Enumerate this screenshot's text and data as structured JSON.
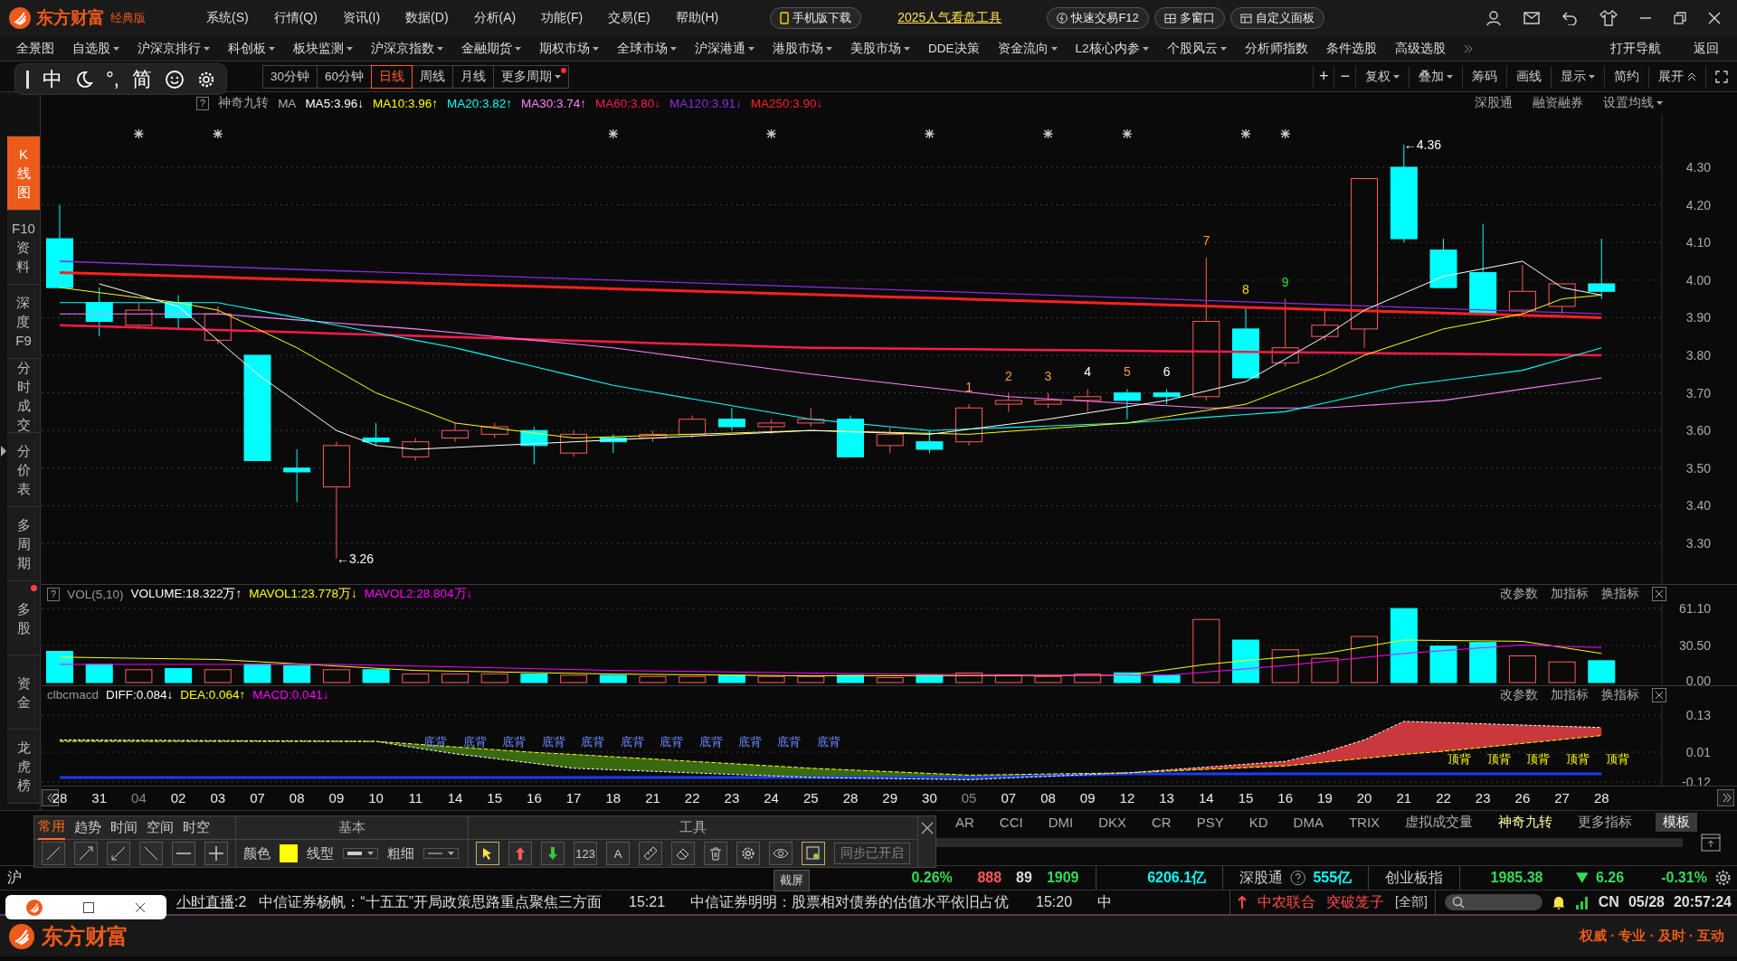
{
  "title_bar": {
    "logo": "东方财富",
    "edition": "经典版",
    "menus": [
      "系统(S)",
      "行情(Q)",
      "资讯(I)",
      "数据(D)",
      "分析(A)",
      "功能(F)",
      "交易(E)",
      "帮助(H)"
    ],
    "mobile_button": "手机版下载",
    "promo_link": "2025人气看盘工具",
    "quick_trade": "快速交易F12",
    "multi_window": "多窗口",
    "custom_panel": "自定义面板"
  },
  "menu_bar": [
    {
      "label": "全景图",
      "dropdown": false
    },
    {
      "label": "自选股",
      "dropdown": true
    },
    {
      "label": "沪深京排行",
      "dropdown": true
    },
    {
      "label": "科创板",
      "dropdown": true
    },
    {
      "label": "板块监测",
      "dropdown": true
    },
    {
      "label": "沪深京指数",
      "dropdown": true
    },
    {
      "label": "金融期货",
      "dropdown": true
    },
    {
      "label": "期权市场",
      "dropdown": true
    },
    {
      "label": "全球市场",
      "dropdown": true
    },
    {
      "label": "沪深港通",
      "dropdown": true
    },
    {
      "label": "港股市场",
      "dropdown": true
    },
    {
      "label": "美股市场",
      "dropdown": true
    },
    {
      "label": "DDE决策",
      "dropdown": false
    },
    {
      "label": "资金流向",
      "dropdown": true
    },
    {
      "label": "L2核心内参",
      "dropdown": true
    },
    {
      "label": "个股风云",
      "dropdown": true
    },
    {
      "label": "分析师指数",
      "dropdown": false
    },
    {
      "label": "条件选股",
      "dropdown": false
    },
    {
      "label": "高级选股",
      "dropdown": false
    }
  ],
  "menu_bar_right": [
    "打开导航",
    "返回"
  ],
  "float_toolbar": [
    {
      "kind": "handle"
    },
    {
      "kind": "text",
      "label": "中"
    },
    {
      "kind": "moon"
    },
    {
      "kind": "text",
      "label": "°,"
    },
    {
      "kind": "text",
      "label": "简"
    },
    {
      "kind": "smile"
    },
    {
      "kind": "gear"
    }
  ],
  "period_tabs": [
    {
      "label": "30分钟",
      "selected": false,
      "dropdown": false,
      "alert": false
    },
    {
      "label": "60分钟",
      "selected": false,
      "dropdown": false,
      "alert": false
    },
    {
      "label": "日线",
      "selected": true,
      "dropdown": false,
      "alert": false
    },
    {
      "label": "周线",
      "selected": false,
      "dropdown": false,
      "alert": false
    },
    {
      "label": "月线",
      "selected": false,
      "dropdown": false,
      "alert": false
    },
    {
      "label": "更多周期",
      "selected": false,
      "dropdown": true,
      "alert": true
    }
  ],
  "chart_tools": [
    {
      "kind": "icon",
      "label": "+",
      "dropdown": false
    },
    {
      "kind": "icon",
      "label": "−",
      "dropdown": false
    },
    {
      "kind": "text",
      "label": "复权",
      "dropdown": true
    },
    {
      "kind": "text",
      "label": "叠加",
      "dropdown": true
    },
    {
      "kind": "text",
      "label": "筹码",
      "dropdown": false
    },
    {
      "kind": "text",
      "label": "画线",
      "dropdown": false
    },
    {
      "kind": "text",
      "label": "显示",
      "dropdown": true
    },
    {
      "kind": "text",
      "label": "简约",
      "dropdown": false
    },
    {
      "kind": "expand",
      "label": "展开",
      "dropdown": false
    },
    {
      "kind": "fullscreen"
    }
  ],
  "sidebar": [
    {
      "label": "K线图",
      "selected": true,
      "alert": false
    },
    {
      "label": "F10资料",
      "selected": false,
      "alert": false
    },
    {
      "label": "深度F9",
      "selected": false,
      "alert": false
    },
    {
      "label": "分时成交",
      "selected": false,
      "alert": false
    },
    {
      "label": "分价表",
      "selected": false,
      "alert": false
    },
    {
      "label": "多周期",
      "selected": false,
      "alert": false
    },
    {
      "label": "多股",
      "selected": false,
      "alert": true
    },
    {
      "label": "资金",
      "selected": false,
      "alert": false
    },
    {
      "label": "龙虎榜",
      "selected": false,
      "alert": false
    }
  ],
  "ma_bar": {
    "help": "?",
    "indicator": "神奇九转",
    "label": "MA",
    "values": [
      {
        "text": "MA5:3.96↓",
        "color": "#ffffff"
      },
      {
        "text": "MA10:3.96↑",
        "color": "#ffff00"
      },
      {
        "text": "MA20:3.82↑",
        "color": "#00ffff"
      },
      {
        "text": "MA30:3.74↑",
        "color": "#ff80ff"
      },
      {
        "text": "MA60:3.80↓",
        "color": "#ff1a4a"
      },
      {
        "text": "MA120:3.91↓",
        "color": "#8a2be2"
      },
      {
        "text": "MA250:3.90↓",
        "color": "#ff2020"
      }
    ],
    "links": [
      "深股通",
      "融资融券",
      "设置均线"
    ]
  },
  "price_chart": {
    "ticks": [
      "4.30",
      "4.20",
      "4.10",
      "4.00",
      "3.90",
      "3.80",
      "3.70",
      "3.60",
      "3.50",
      "3.40",
      "3.30"
    ],
    "high_label": "←4.36",
    "low_label": "←3.26",
    "nine_turn": [
      {
        "text": "1",
        "color": "#ff9f2a"
      },
      {
        "text": "2",
        "color": "#ff9f2a"
      },
      {
        "text": "3",
        "color": "#ff9f2a"
      },
      {
        "text": "4",
        "color": "#ffffff"
      },
      {
        "text": "5",
        "color": "#ff9f2a"
      },
      {
        "text": "6",
        "color": "#ffffff"
      },
      {
        "text": "7",
        "color": "#ff9f2a"
      },
      {
        "text": "8",
        "color": "#ffd700"
      },
      {
        "text": "9",
        "color": "#33dd33"
      }
    ]
  },
  "volume_panel": {
    "help": "?",
    "name": "VOL(5,10)",
    "values": [
      {
        "text": "VOLUME:18.322万↑",
        "color": "#ffffff"
      },
      {
        "text": "MAVOL1:23.778万↓",
        "color": "#ffff00"
      },
      {
        "text": "MAVOL2:28.804万↓",
        "color": "#ff00ff"
      }
    ],
    "actions": [
      "改参数",
      "加指标",
      "换指标"
    ],
    "ticks": [
      "61.10",
      "30.50",
      "0.00"
    ]
  },
  "macd_panel": {
    "name": "clbcmacd",
    "values": [
      {
        "text": "DIFF:0.084↓",
        "color": "#ffffff"
      },
      {
        "text": "DEA:0.064↑",
        "color": "#ffff00"
      },
      {
        "text": "MACD:0.041↓",
        "color": "#ff00ff"
      }
    ],
    "actions": [
      "改参数",
      "加指标",
      "换指标"
    ],
    "ticks": [
      "0.13",
      "0.01",
      "-0.12"
    ],
    "bottom_signals": [
      "底背",
      "底背",
      "底背",
      "底背",
      "底背",
      "底背",
      "底背",
      "底背",
      "底背",
      "底背",
      "底背"
    ],
    "top_signals": [
      "顶背",
      "顶背",
      "顶背",
      "顶背",
      "顶背"
    ]
  },
  "date_axis": [
    {
      "text": "28",
      "month": false
    },
    {
      "text": "31",
      "month": false
    },
    {
      "text": "04",
      "month": true
    },
    {
      "text": "02",
      "month": false
    },
    {
      "text": "03",
      "month": false
    },
    {
      "text": "07",
      "month": false
    },
    {
      "text": "08",
      "month": false
    },
    {
      "text": "09",
      "month": false
    },
    {
      "text": "10",
      "month": false
    },
    {
      "text": "11",
      "month": false
    },
    {
      "text": "14",
      "month": false
    },
    {
      "text": "15",
      "month": false
    },
    {
      "text": "16",
      "month": false
    },
    {
      "text": "17",
      "month": false
    },
    {
      "text": "18",
      "month": false
    },
    {
      "text": "21",
      "month": false
    },
    {
      "text": "22",
      "month": false
    },
    {
      "text": "23",
      "month": false
    },
    {
      "text": "24",
      "month": false
    },
    {
      "text": "25",
      "month": false
    },
    {
      "text": "28",
      "month": false
    },
    {
      "text": "29",
      "month": false
    },
    {
      "text": "30",
      "month": false
    },
    {
      "text": "05",
      "month": true
    },
    {
      "text": "07",
      "month": false
    },
    {
      "text": "08",
      "month": false
    },
    {
      "text": "09",
      "month": false
    },
    {
      "text": "12",
      "month": false
    },
    {
      "text": "13",
      "month": false
    },
    {
      "text": "14",
      "month": false
    },
    {
      "text": "15",
      "month": false
    },
    {
      "text": "16",
      "month": false
    },
    {
      "text": "19",
      "month": false
    },
    {
      "text": "20",
      "month": false
    },
    {
      "text": "21",
      "month": false
    },
    {
      "text": "22",
      "month": false
    },
    {
      "text": "23",
      "month": false
    },
    {
      "text": "26",
      "month": false
    },
    {
      "text": "27",
      "month": false
    },
    {
      "text": "28",
      "month": false
    }
  ],
  "indicator_tabs": [
    {
      "kind": "tab",
      "label": "AR",
      "selected": false
    },
    {
      "kind": "tab",
      "label": "CCI",
      "selected": false
    },
    {
      "kind": "tab",
      "label": "DMI",
      "selected": false
    },
    {
      "kind": "tab",
      "label": "DKX",
      "selected": false
    },
    {
      "kind": "tab",
      "label": "CR",
      "selected": false
    },
    {
      "kind": "tab",
      "label": "PSY",
      "selected": false
    },
    {
      "kind": "tab",
      "label": "KD",
      "selected": false
    },
    {
      "kind": "tab",
      "label": "DMA",
      "selected": false
    },
    {
      "kind": "tab",
      "label": "TRIX",
      "selected": false
    },
    {
      "kind": "tab",
      "label": "虚拟成交量",
      "selected": false
    },
    {
      "kind": "tab",
      "label": "神奇九转",
      "selected": true
    },
    {
      "kind": "tab",
      "label": "更多指标",
      "selected": false
    },
    {
      "kind": "button",
      "label": "模板",
      "selected": false
    }
  ],
  "draw_panel": {
    "tabs": [
      {
        "label": "常用",
        "selected": true
      },
      {
        "label": "趋势",
        "selected": false
      },
      {
        "label": "时间",
        "selected": false
      },
      {
        "label": "空间",
        "selected": false
      },
      {
        "label": "时空",
        "selected": false
      }
    ],
    "basic_title": "基本",
    "tools_title": "工具",
    "color_label": "颜色",
    "color": "#ffff00",
    "line_type_label": "线型",
    "thickness_label": "粗细",
    "tools": [
      {
        "kind": "cursor"
      },
      {
        "kind": "up"
      },
      {
        "kind": "down"
      },
      {
        "kind": "text",
        "label": "123"
      },
      {
        "kind": "text",
        "label": "A"
      },
      {
        "kind": "ruler"
      },
      {
        "kind": "eraser"
      },
      {
        "kind": "trash"
      },
      {
        "kind": "gear"
      },
      {
        "kind": "eye"
      },
      {
        "kind": "screenshot"
      }
    ],
    "sync_button": "同步已开启",
    "tooltip": "截屏"
  },
  "status_bar": {
    "market": "沪",
    "items": [
      {
        "text": "0.26%",
        "color": "#33dd55"
      },
      {
        "text": "888",
        "color": "#ff5a5a"
      },
      {
        "text": "89",
        "color": "#dddddd"
      },
      {
        "text": "1909",
        "color": "#33dd55"
      },
      {
        "text": "6206.1亿",
        "color": "#00ffff"
      },
      {
        "text": "深股通",
        "color": "#cccccc"
      },
      {
        "text": "555亿",
        "color": "#00ffff"
      },
      {
        "text": "创业板指",
        "color": "#cccccc"
      },
      {
        "text": "1985.38",
        "color": "#33dd55"
      },
      {
        "text": "6.26",
        "color": "#33dd55"
      },
      {
        "text": "-0.31%",
        "color": "#33dd55"
      }
    ]
  },
  "news_bar": {
    "live_link": "小时直播",
    "live_suffix": ":2",
    "items": [
      {
        "kind": "headline",
        "text": "中信证券杨帆：“十五五”开局政策思路重点聚焦三方面"
      },
      {
        "kind": "time",
        "text": "15:21"
      },
      {
        "kind": "headline",
        "text": "中信证券明明：股票相对债券的估值水平依旧占优"
      },
      {
        "kind": "time",
        "text": "15:20"
      },
      {
        "kind": "headline",
        "text": "中"
      }
    ],
    "alert_stock": "中农联合",
    "alert_signal": "突破笼子",
    "filter": "[全部]",
    "region": "CN",
    "date": "05/28",
    "time": "20:57:24"
  },
  "brand_bar": {
    "logo": "东方财富",
    "slogan": "权威 · 专业 · 及时 · 互动"
  }
}
